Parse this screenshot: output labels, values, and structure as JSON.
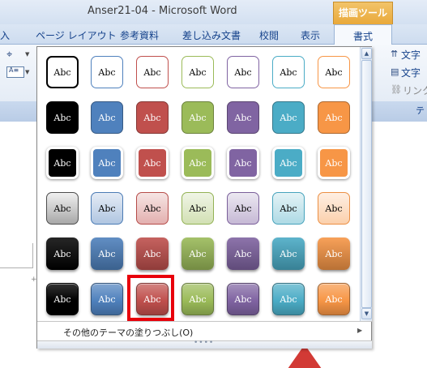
{
  "window": {
    "title": "Anser21-04 - Microsoft Word",
    "context_group": "描画ツール"
  },
  "tabs": [
    {
      "label": "入",
      "active": false
    },
    {
      "label": "ページ レイアウト",
      "active": false
    },
    {
      "label": "参考資料",
      "active": false
    },
    {
      "label": "差し込み文書",
      "active": false
    },
    {
      "label": "校閲",
      "active": false
    },
    {
      "label": "表示",
      "active": false
    },
    {
      "label": "書式",
      "active": true
    }
  ],
  "ribbon_right": {
    "item1": "文字",
    "item2": "文字",
    "item3": "リンク",
    "item4": "テ"
  },
  "gallery": {
    "tile_text": "Abc",
    "column_colors": [
      "#000000",
      "#4f81bd",
      "#c0504d",
      "#9bbb59",
      "#8064a2",
      "#4bacc6",
      "#f79646"
    ],
    "rows": [
      {
        "style": "outline"
      },
      {
        "style": "fill"
      },
      {
        "style": "fill-white-outline"
      },
      {
        "style": "light-gradient"
      },
      {
        "style": "intense"
      },
      {
        "style": "bevel"
      }
    ],
    "selected": {
      "row": 6,
      "column": 3
    },
    "menu_item": "その他のテーマの塗りつぶし(O)",
    "grip": "••••"
  }
}
